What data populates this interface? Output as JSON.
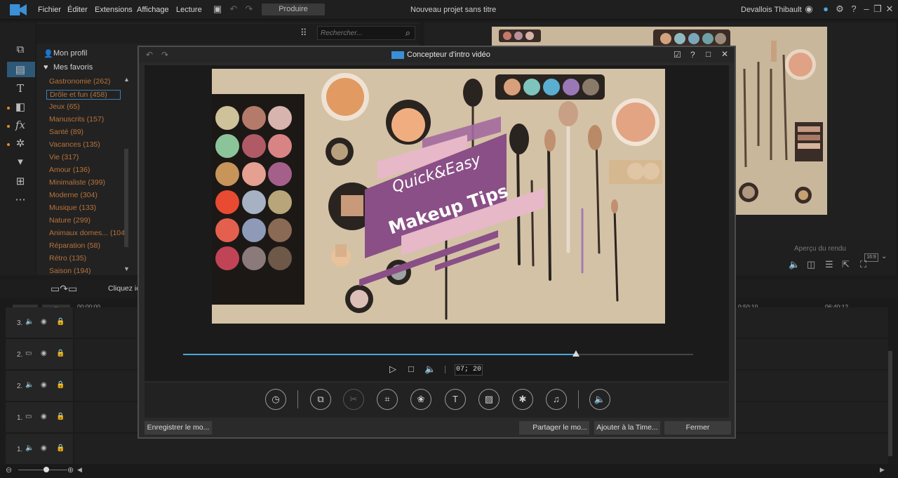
{
  "menubar": {
    "items": [
      "Fichier",
      "Éditer",
      "Extensions",
      "Affichage",
      "Lecture"
    ],
    "produce_label": "Produire",
    "project_title": "Nouveau projet sans titre",
    "user_name": "Devallois Thibault"
  },
  "library": {
    "search_placeholder": "Rechercher...",
    "profile_label": "Mon profil",
    "favorites_label": "Mes favoris",
    "categories": [
      "Gastronomie  (262)",
      "Drôle et fun  (458)",
      "Jeux  (65)",
      "Manuscrits  (157)",
      "Santé  (89)",
      "Vacances  (135)",
      "Vie  (317)",
      "Amour  (136)",
      "Minimaliste  (399)",
      "Moderne  (304)",
      "Musique  (133)",
      "Nature  (299)",
      "Animaux domes...  (104",
      "Réparation  (58)",
      "Rétro  (135)",
      "Saison  (194)"
    ],
    "selected_index": 1
  },
  "preview": {
    "label": "Aperçu du rendu",
    "aspect": "16:9"
  },
  "timeline": {
    "hint": "Cliquez ic",
    "ruler_start": "00;00;00",
    "ruler_mid": "0;50;10",
    "ruler_end": "06;40;12",
    "tracks": [
      "3.",
      "2.",
      "2.",
      "1.",
      "1."
    ]
  },
  "modal": {
    "title": "Concepteur d'intro vidéo",
    "video_title_line1": "Quick&Easy",
    "video_title_line2": "Makeup Tips",
    "timecode": "07; 20",
    "progress": 0.77,
    "save_label": "Enregistrer le mo...",
    "share_label": "Partager le mo...",
    "add_label": "Ajouter à la Time...",
    "close_label": "Fermer"
  },
  "colors": {
    "accent": "#4aa8d8",
    "category": "#b9733a",
    "banner_purple": "#8a4f86",
    "banner_pink": "#e6b8c8"
  }
}
